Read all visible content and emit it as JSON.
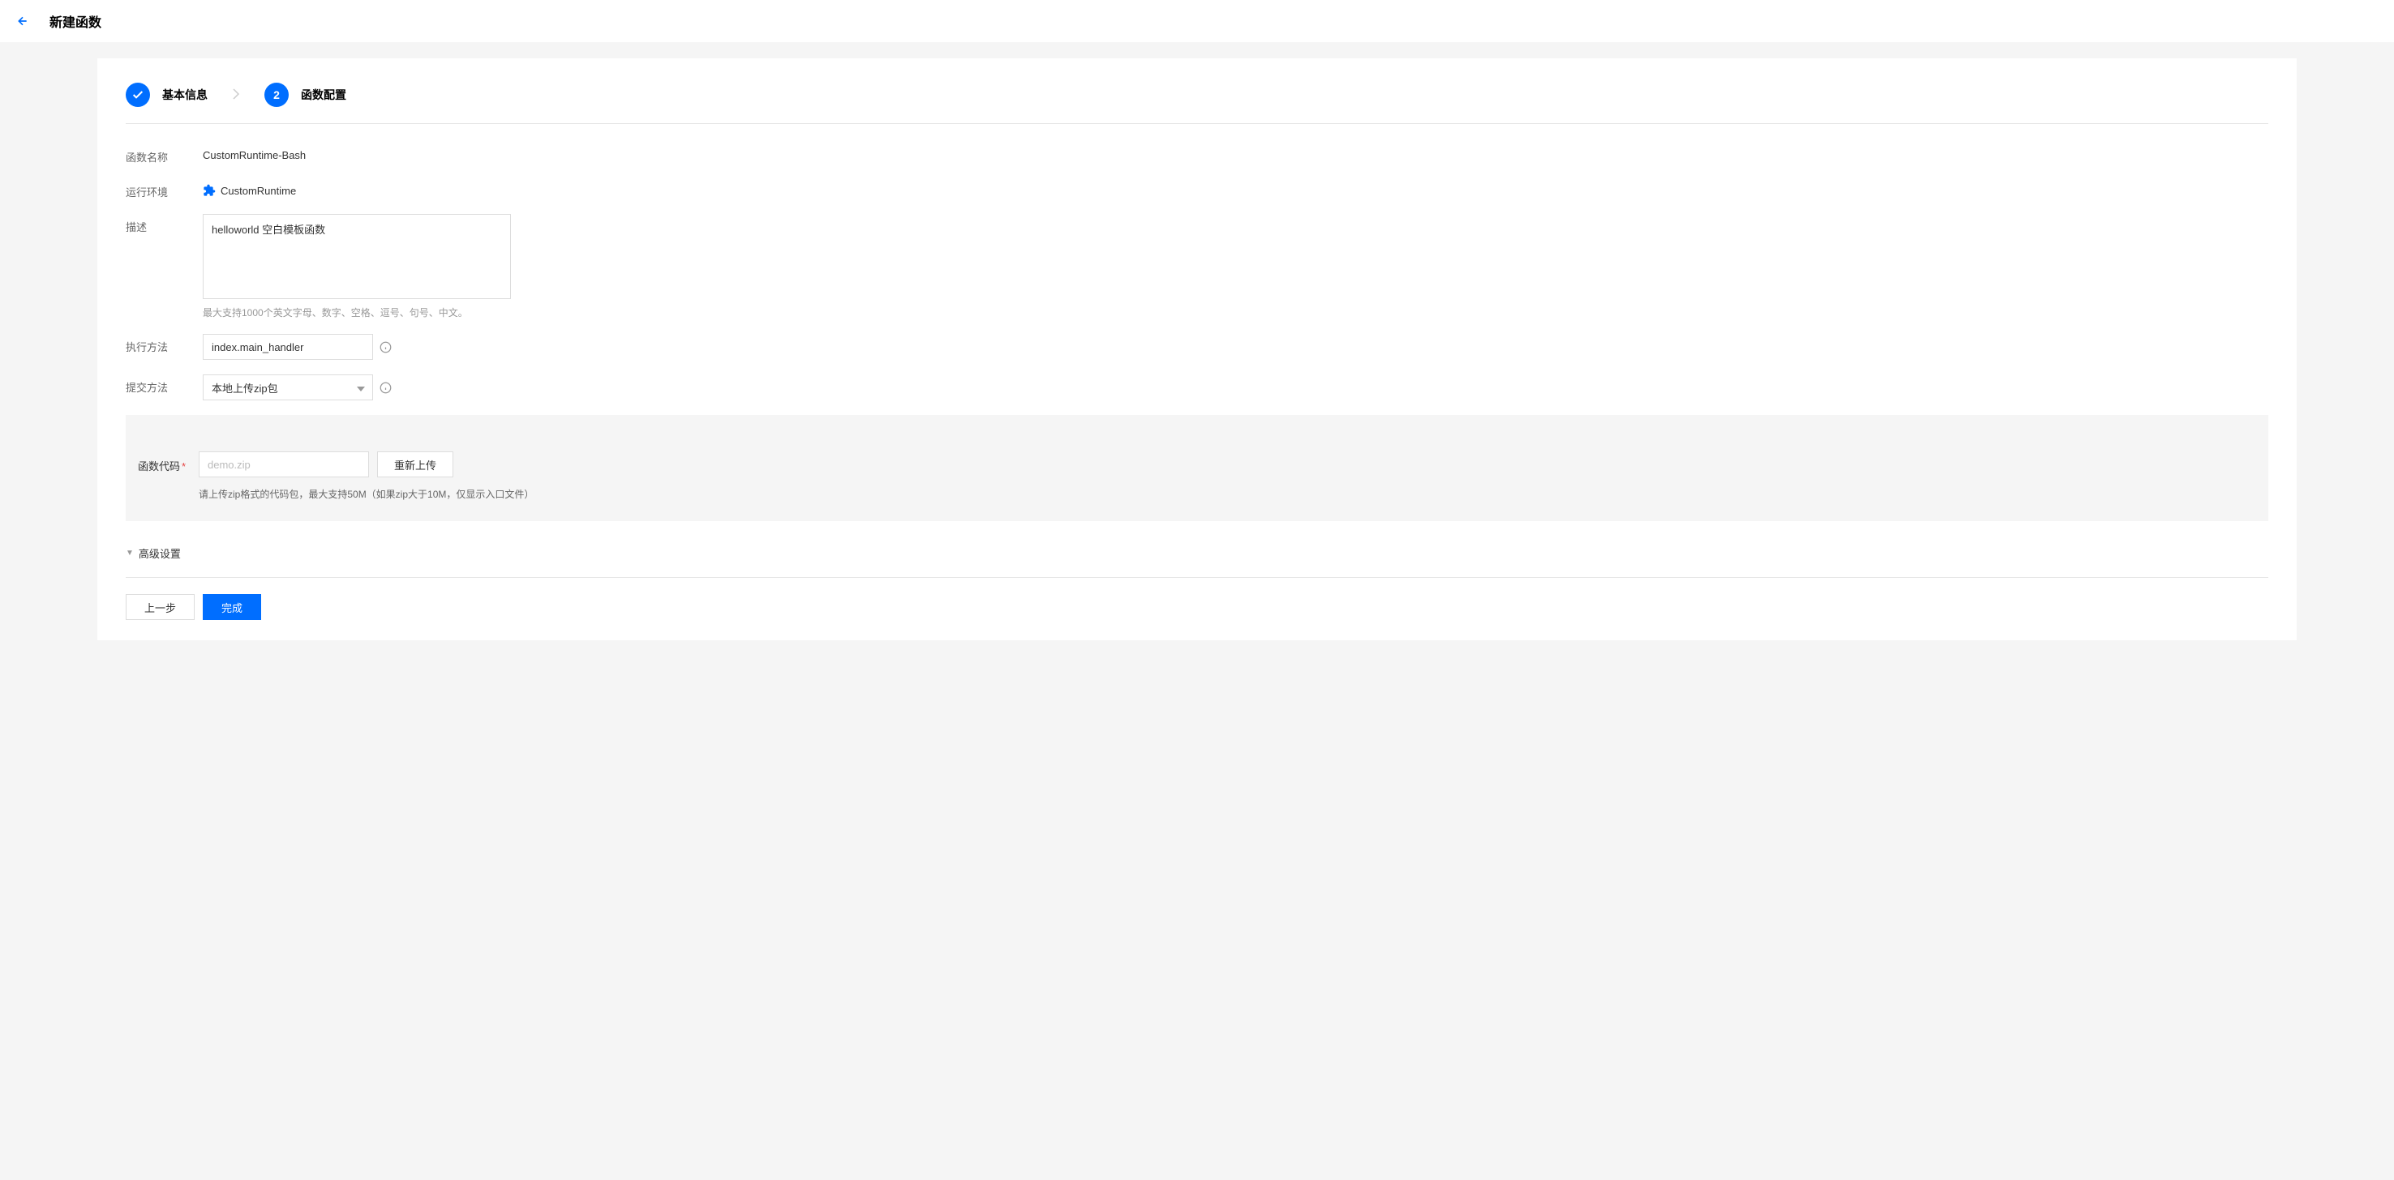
{
  "header": {
    "title": "新建函数"
  },
  "stepper": {
    "step1_label": "基本信息",
    "step2_number": "2",
    "step2_label": "函数配置"
  },
  "form": {
    "function_name_label": "函数名称",
    "function_name_value": "CustomRuntime-Bash",
    "runtime_label": "运行环境",
    "runtime_value": "CustomRuntime",
    "description_label": "描述",
    "description_value": "helloworld 空白模板函数",
    "description_hint": "最大支持1000个英文字母、数字、空格、逗号、句号、中文。",
    "handler_label": "执行方法",
    "handler_value": "index.main_handler",
    "submit_method_label": "提交方法",
    "submit_method_value": "本地上传zip包",
    "code_label": "函数代码",
    "code_placeholder": "demo.zip",
    "reupload_label": "重新上传",
    "code_hint": "请上传zip格式的代码包，最大支持50M（如果zip大于10M，仅显示入口文件）",
    "advanced_label": "高级设置"
  },
  "footer": {
    "prev_label": "上一步",
    "finish_label": "完成"
  }
}
